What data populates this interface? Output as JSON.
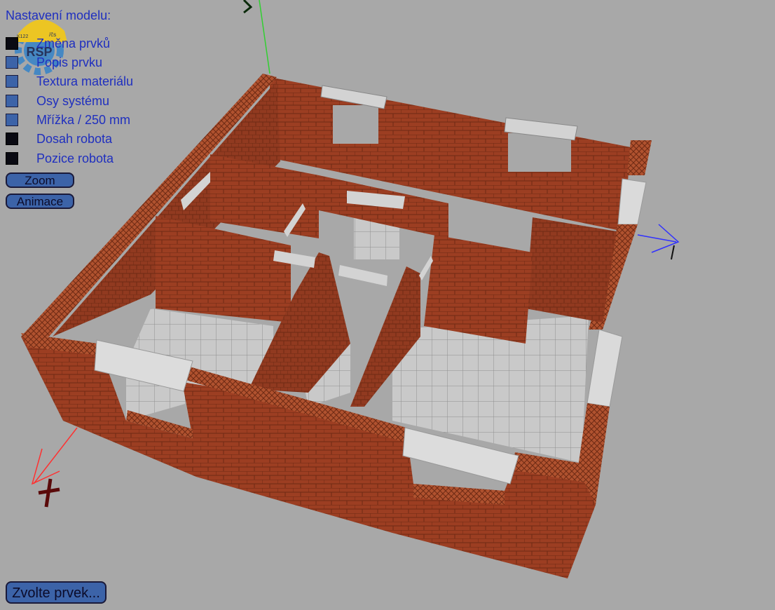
{
  "panel": {
    "title": "Nastavení modelu:",
    "options": [
      {
        "label": "Změna prvků",
        "checked": true
      },
      {
        "label": "Popis prvku",
        "checked": false
      },
      {
        "label": "Textura materiálu",
        "checked": false
      },
      {
        "label": "Osy systému",
        "checked": false
      },
      {
        "label": "Mřížka / 250 mm",
        "checked": false
      },
      {
        "label": "Dosah robota",
        "checked": true
      },
      {
        "label": "Pozice robota",
        "checked": true
      }
    ],
    "zoom_label": "Zoom",
    "animate_label": "Animace"
  },
  "logo": {
    "text": "RSP",
    "small_left": "K122",
    "small_right": "/čs"
  },
  "bottom_button_label": "Zvolte prvek...",
  "colors": {
    "background": "#a8a8a8",
    "brick": "#9c3e22",
    "brick_dark": "#7a2c16",
    "lintel": "#d3d3d3",
    "floor": "#c9c9c9",
    "ui_blue": "#3c63a8",
    "label_blue": "#1f2fbf",
    "axis_x": "#ff3030",
    "axis_y": "#30d030",
    "axis_z": "#3030ff"
  }
}
